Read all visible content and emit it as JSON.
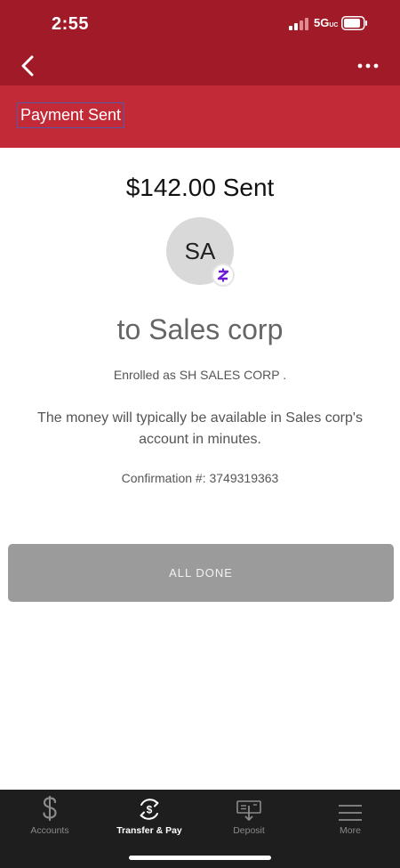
{
  "status_bar": {
    "time": "2:55",
    "network": "5G",
    "network_suffix": "UC"
  },
  "header": {
    "title": "Payment Sent"
  },
  "payment": {
    "amount_text": "$142.00 Sent",
    "avatar_initials": "SA",
    "recipient_text": "to Sales corp",
    "enrolled_text": "Enrolled as SH SALES CORP .",
    "availability_text": "The money will typically be available in Sales corp's account in minutes.",
    "confirmation_text": "Confirmation #: 3749319363"
  },
  "actions": {
    "done_label": "ALL DONE"
  },
  "tab_bar": {
    "tabs": [
      {
        "label": "Accounts",
        "icon": "dollar-icon",
        "active": false
      },
      {
        "label": "Transfer & Pay",
        "icon": "transfer-pay-icon",
        "active": true
      },
      {
        "label": "Deposit",
        "icon": "deposit-icon",
        "active": false
      },
      {
        "label": "More",
        "icon": "menu-icon",
        "active": false
      }
    ]
  },
  "colors": {
    "header_dark": "#a11a28",
    "header_light": "#c22a38",
    "button_gray": "#9b9b9b",
    "tab_bar": "#1e1e1e",
    "zelle_purple": "#6d1ed4"
  }
}
